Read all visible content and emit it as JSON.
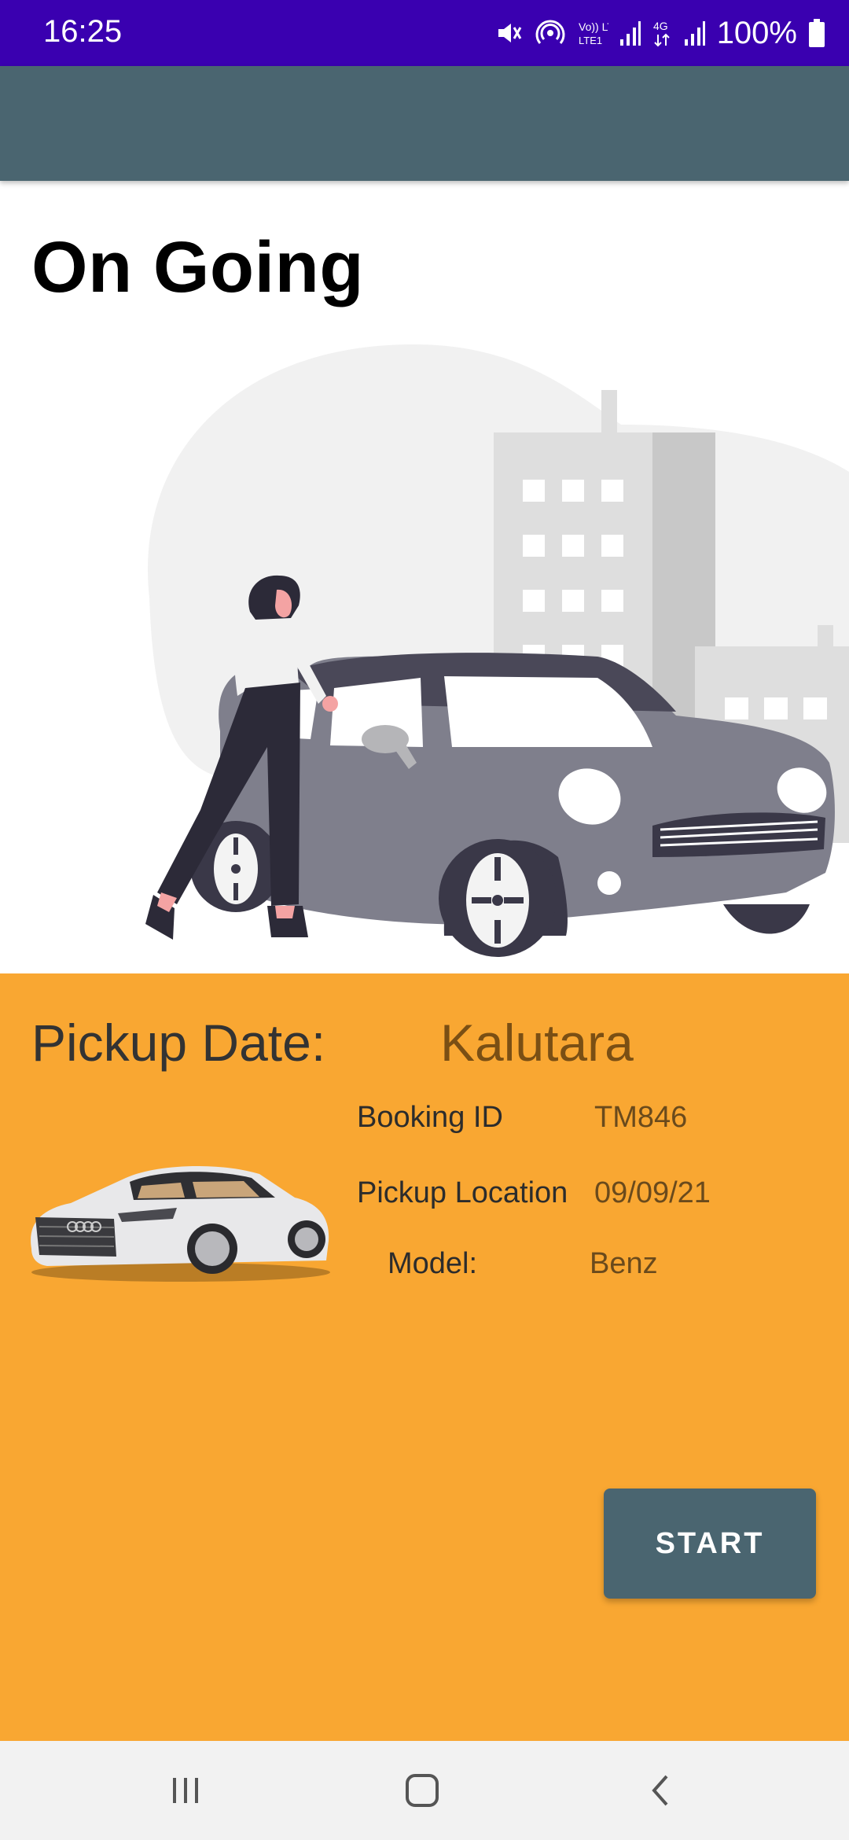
{
  "status_bar": {
    "time": "16:25",
    "battery_percent": "100%",
    "icons": [
      "mute-icon",
      "hotspot-icon",
      "volte-icon",
      "signal-icon",
      "4g-icon",
      "signal-icon",
      "battery-icon"
    ],
    "network_label": "Vo)) LTE1",
    "network_type": "4G"
  },
  "page": {
    "title": "On Going"
  },
  "booking": {
    "pickup_date_label": "Pickup Date:",
    "pickup_date_value": "Kalutara",
    "booking_id_label": "Booking ID",
    "booking_id_value": "TM846",
    "pickup_location_label": "Pickup Location",
    "pickup_location_value": "09/09/21",
    "model_label": "Model:",
    "model_value": "Benz"
  },
  "actions": {
    "start_label": "START"
  },
  "colors": {
    "status_bar": "#3a00b0",
    "app_bar": "#4a6570",
    "panel": "#f9a732",
    "button": "#4a6570"
  },
  "nav": {
    "icons": [
      "recent-apps-icon",
      "home-icon",
      "back-icon"
    ]
  }
}
